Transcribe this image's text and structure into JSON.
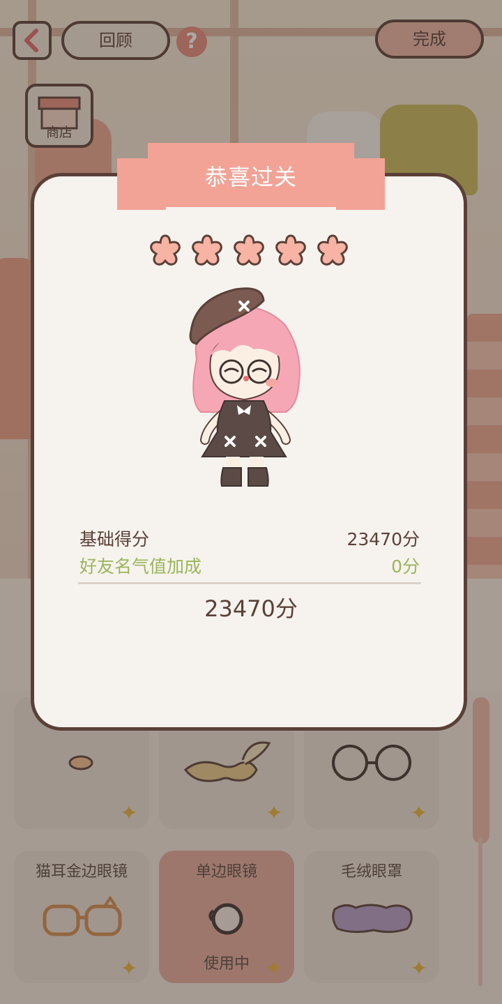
{
  "topbar": {
    "back_icon": "chevron-left-icon",
    "review_label": "回顾",
    "help_icon": "question-icon",
    "done_label": "完成",
    "shop_label": "商店"
  },
  "modal": {
    "title": "恭喜过关",
    "stars": 5,
    "base_score_label": "基础得分",
    "base_score_value": "23470分",
    "bonus_label": "好友名气值加成",
    "bonus_value": "0分",
    "total": "23470分"
  },
  "items": [
    {
      "name": "猫耳金边眼镜",
      "status": ""
    },
    {
      "name": "单边眼镜",
      "status": "使用中"
    },
    {
      "name": "毛绒眼罩",
      "status": ""
    }
  ],
  "colors": {
    "accent": "#f2a396",
    "outline": "#5b4038",
    "bonus_text": "#9cb55c",
    "star": "#f7b3a3"
  }
}
